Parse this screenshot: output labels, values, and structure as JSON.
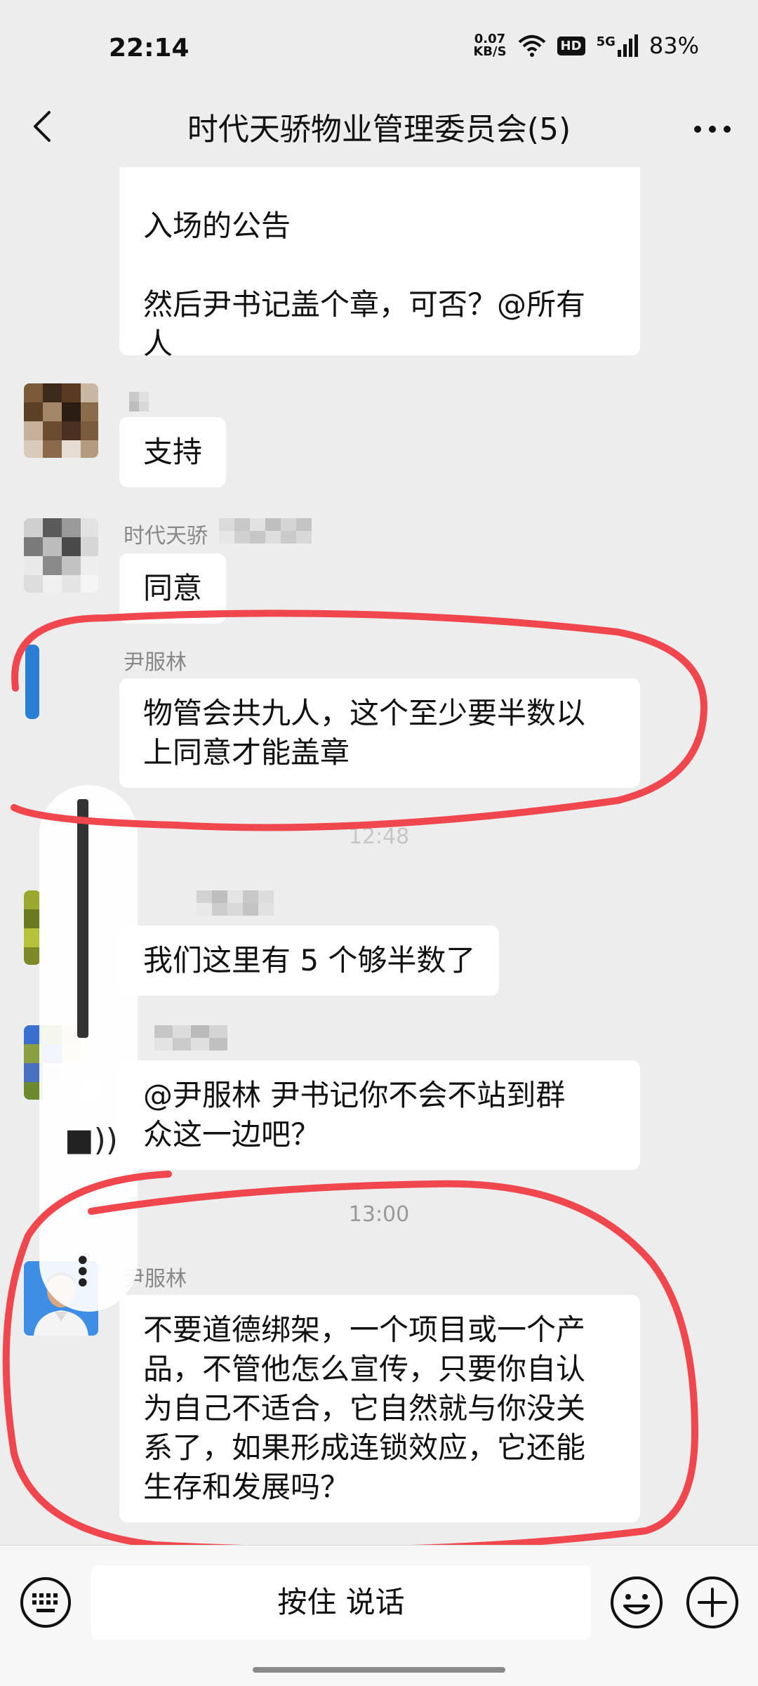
{
  "status_bar": {
    "time": "22:14",
    "net_speed_value": "0.07",
    "net_speed_unit": "KB/S",
    "hd_badge": "HD",
    "network_type": "5G",
    "battery": "83%"
  },
  "nav": {
    "title": "时代天骄物业管理委员会(5)"
  },
  "messages": [
    {
      "text_line1": "入场的公告",
      "text_line2": "然后尹书记盖个章，可否？@所有",
      "text_line3": "人"
    },
    {
      "text": "支持"
    },
    {
      "sender": "时代天骄",
      "text": "同意"
    },
    {
      "sender": "尹服林",
      "text_line1": "物管会共九人，这个至少要半数以",
      "text_line2": "上同意才能盖章"
    },
    {
      "text": "我们这里有 5 个够半数了"
    },
    {
      "text_line1": "@尹服林  尹书记你不会不站到群",
      "text_line2": "众这一边吧？"
    },
    {
      "sender": "尹服林",
      "text_line1": "不要道德绑架，一个项目或一个产",
      "text_line2": "品，不管他怎么宣传，只要你自认",
      "text_line3": "为自己不适合，它自然就与你没关",
      "text_line4": "系了，如果形成连锁效应，它还能",
      "text_line5": "生存和发展吗？"
    }
  ],
  "timestamps": [
    "12:48",
    "13:00"
  ],
  "input_bar": {
    "voice_button_label": "按住 说话"
  },
  "colors": {
    "background": "#ededed",
    "bubble": "#ffffff",
    "annotation_red": "#f0464e"
  }
}
